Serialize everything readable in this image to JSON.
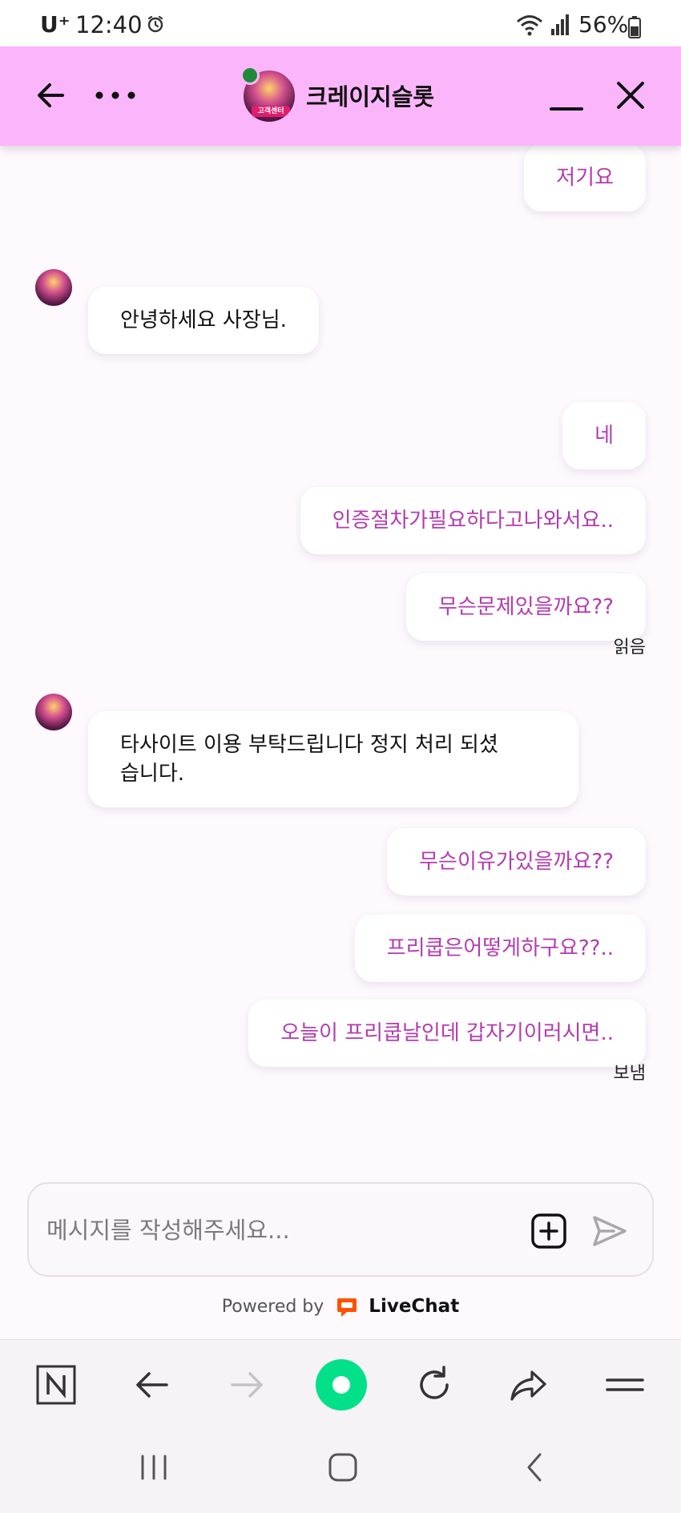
{
  "status_bar": {
    "carrier": "U⁺",
    "time": "12:40",
    "battery": "56%"
  },
  "header": {
    "title": "크레이지슬롯",
    "avatar_label": "고객센터"
  },
  "messages": [
    {
      "direction": "out",
      "text": "저기요"
    },
    {
      "direction": "in",
      "lines": [
        "안녕하세요 사장님."
      ]
    },
    {
      "direction": "out",
      "text": "네"
    },
    {
      "direction": "out",
      "text": "인증절차가필요하다고나와서요.."
    },
    {
      "direction": "out",
      "text": "무슨문제있을까요??"
    },
    {
      "direction": "in",
      "lines": [
        "타사이트 이용 부탁드립니다 정지 처리 되셨",
        "습니다."
      ]
    },
    {
      "direction": "out",
      "text": "무슨이유가있을까요??"
    },
    {
      "direction": "out",
      "text": "프리쿱은어떻게하구요??.."
    },
    {
      "direction": "out",
      "text": "오늘이 프리쿱날인데 갑자기이러시면.."
    }
  ],
  "statuses": {
    "read": "읽음",
    "sent": "보냄"
  },
  "composer": {
    "placeholder": "메시지를 작성해주세요..."
  },
  "footer": {
    "powered_by": "Powered by",
    "brand": "LiveChat"
  },
  "colors": {
    "header_bg": "#fbb6fb",
    "outgoing_text": "#b43bb0",
    "online_dot": "#1f8a3b",
    "livechat_orange": "#ff5100",
    "browser_green": "#03e08a"
  },
  "icons": {
    "header": [
      "back-arrow-icon",
      "more-dots-icon",
      "minimize-icon",
      "close-icon"
    ],
    "composer": [
      "attach-plus-icon",
      "send-icon"
    ],
    "browser": [
      "naver-n-icon",
      "browser-back-icon",
      "browser-forward-icon",
      "home-circle-icon",
      "refresh-icon",
      "share-icon",
      "menu-icon"
    ],
    "system_nav": [
      "recents-icon",
      "home-icon",
      "system-back-icon"
    ]
  }
}
